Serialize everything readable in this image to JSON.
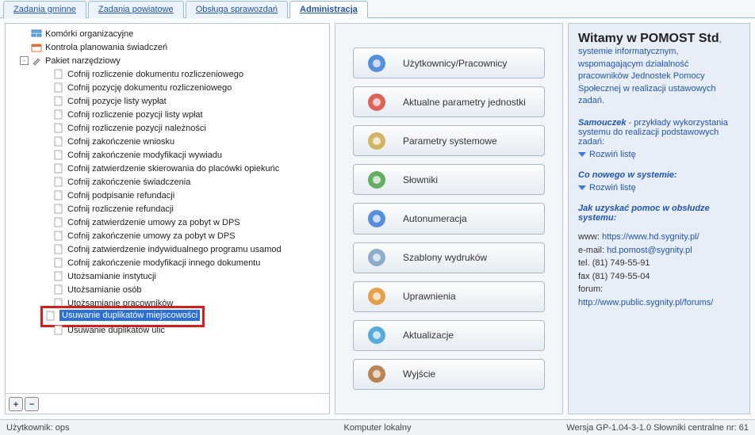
{
  "tabs": [
    {
      "label": "Zadania gminne",
      "active": false
    },
    {
      "label": "Zadania powiatowe",
      "active": false
    },
    {
      "label": "Obsługa sprawozdań",
      "active": false
    },
    {
      "label": "Administracja",
      "active": true
    }
  ],
  "tree": {
    "root": [
      {
        "label": "Komórki organizacyjne",
        "icon": "org-icon",
        "indent": 1
      },
      {
        "label": "Kontrola planowania świadczeń",
        "icon": "cal-icon",
        "indent": 1
      },
      {
        "label": "Pakiet narzędziowy",
        "icon": "tool-icon",
        "indent": 1,
        "toggle": "-",
        "children": true
      }
    ],
    "children": [
      "Cofnij rozliczenie dokumentu rozliczeniowego",
      "Cofnij pozycję dokumentu rozliczeniowego",
      "Cofnij pozycje listy wypłat",
      "Cofnij rozliczenie pozycji listy wpłat",
      "Cofnij rozliczenie pozycji należności",
      "Cofnij zakończenie wniosku",
      "Cofnij zakończenie modyfikacji wywiadu",
      "Cofnij zatwierdzenie skierowania do placówki opiekuńc",
      "Cofnij zakończenie świadczenia",
      "Cofnij podpisanie refundacji",
      "Cofnij rozliczenie refundacji",
      "Cofnij zatwierdzenie umowy za pobyt w DPS",
      "Cofnij zakończenie umowy za pobyt w DPS",
      "Cofnij zatwierdzenie indywidualnego programu usamod",
      "Cofnij zakończenie modyfikacji innego dokumentu",
      "Utożsamianie instytucji",
      "Utożsamianie osób",
      "Utożsamianie pracowników",
      "Usuwanie duplikatów miejscowości",
      "Usuwanie duplikatów ulic"
    ],
    "selected_index": 18,
    "highlight_index": 18
  },
  "center_buttons": [
    {
      "label": "Użytkownicy/Pracownicy",
      "icon": "users-icon",
      "color": "#3b7dd8"
    },
    {
      "label": "Aktualne parametry jednostki",
      "icon": "edit-icon",
      "color": "#d84a3b"
    },
    {
      "label": "Parametry systemowe",
      "icon": "gears-icon",
      "color": "#c9a94a"
    },
    {
      "label": "Słowniki",
      "icon": "books-icon",
      "color": "#4aa04a"
    },
    {
      "label": "Autonumeracja",
      "icon": "calc-icon",
      "color": "#3b7dd8"
    },
    {
      "label": "Szablony wydruków",
      "icon": "printer-icon",
      "color": "#7aa0c0"
    },
    {
      "label": "Uprawnienia",
      "icon": "person-icon",
      "color": "#e0902a"
    },
    {
      "label": "Aktualizacje",
      "icon": "refresh-icon",
      "color": "#3b9dd8"
    },
    {
      "label": "Wyjście",
      "icon": "door-icon",
      "color": "#b0703a"
    }
  ],
  "right": {
    "title": "Witamy w POMOST Std",
    "lead": ", systemie informatycznym, wspomagającym działalność pracowników Jednostek Pomocy Społecznej w realizacji ustawowych zadań.",
    "samouczek_title": "Samouczek",
    "samouczek_rest": " - przykłady wykorzystania systemu do realizacji podstawowych zadań:",
    "rozwin": "Rozwiń listę",
    "co_nowego": "Co nowego w systemie:",
    "pomoc_title": "Jak uzyskać pomoc w obsłudze systemu:",
    "www_label": "www:",
    "www_link": "https://www.hd.sygnity.pl/",
    "email_label": "e-mail:",
    "email_link": "hd.pomost@sygnity.pl",
    "tel_label": "tel. (81) 749-55-91",
    "fax_label": "fax (81) 749-55-04",
    "forum_label": "forum:",
    "forum_link": "http://www.public.sygnity.pl/forums/"
  },
  "status": {
    "left": "Użytkownik: ops",
    "center": "Komputer lokalny",
    "right": "Wersja GP-1.04-3-1.0 Słowniki centralne nr: 61"
  },
  "footer_buttons": {
    "plus": "+",
    "minus": "−"
  }
}
